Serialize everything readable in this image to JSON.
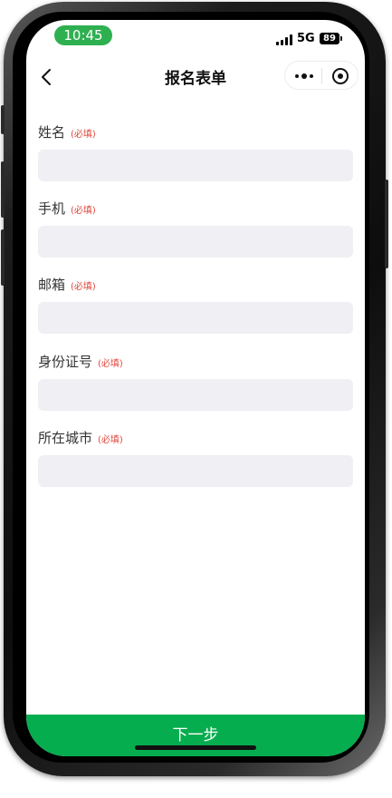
{
  "status_bar": {
    "time": "10:45",
    "network": "5G",
    "battery": "89"
  },
  "nav": {
    "back_icon": "chevron-left-icon",
    "title": "报名表单",
    "more_icon": "more-dots-icon",
    "close_icon": "target-circle-icon"
  },
  "form": {
    "required_tag": "(必填)",
    "fields": [
      {
        "label": "姓名",
        "required": true,
        "value": ""
      },
      {
        "label": "手机",
        "required": true,
        "value": ""
      },
      {
        "label": "邮箱",
        "required": true,
        "value": ""
      },
      {
        "label": "身份证号",
        "required": true,
        "value": ""
      },
      {
        "label": "所在城市",
        "required": true,
        "value": ""
      }
    ]
  },
  "footer": {
    "next_label": "下一步"
  },
  "colors": {
    "accent": "#06ad4f",
    "time_pill": "#2fb050",
    "required": "#e0463b",
    "input_bg": "#efeff4"
  }
}
